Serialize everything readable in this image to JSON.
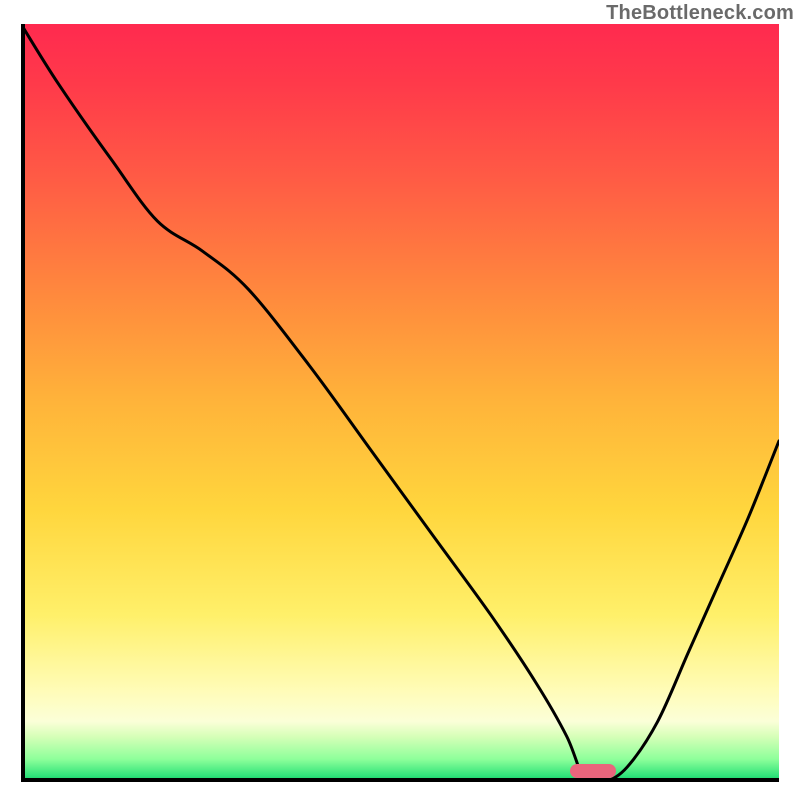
{
  "domain": "Chart",
  "watermark": "TheBottleneck.com",
  "chart_data": {
    "type": "line",
    "x": [
      0.0,
      0.05,
      0.12,
      0.18,
      0.24,
      0.3,
      0.38,
      0.46,
      0.54,
      0.62,
      0.68,
      0.72,
      0.745,
      0.77,
      0.8,
      0.84,
      0.88,
      0.92,
      0.96,
      1.0
    ],
    "y": [
      100,
      92,
      82,
      74,
      70,
      65,
      55,
      44,
      33,
      22,
      13,
      6,
      0,
      0,
      2,
      8,
      17,
      26,
      35,
      45
    ],
    "xlim": [
      0,
      1
    ],
    "ylim": [
      0,
      100
    ],
    "xlabel": "",
    "ylabel": "",
    "title": "",
    "background_gradient": {
      "orientation": "vertical",
      "stops": [
        {
          "pos": 0.0,
          "color": "#ff2a4f"
        },
        {
          "pos": 0.5,
          "color": "#ffb43a"
        },
        {
          "pos": 0.8,
          "color": "#fff06a"
        },
        {
          "pos": 0.95,
          "color": "#d6ffb8"
        },
        {
          "pos": 1.0,
          "color": "#16c463"
        }
      ]
    },
    "marker": {
      "x": 0.755,
      "y": 1.5,
      "shape": "pill",
      "color": "#e9657c"
    }
  }
}
